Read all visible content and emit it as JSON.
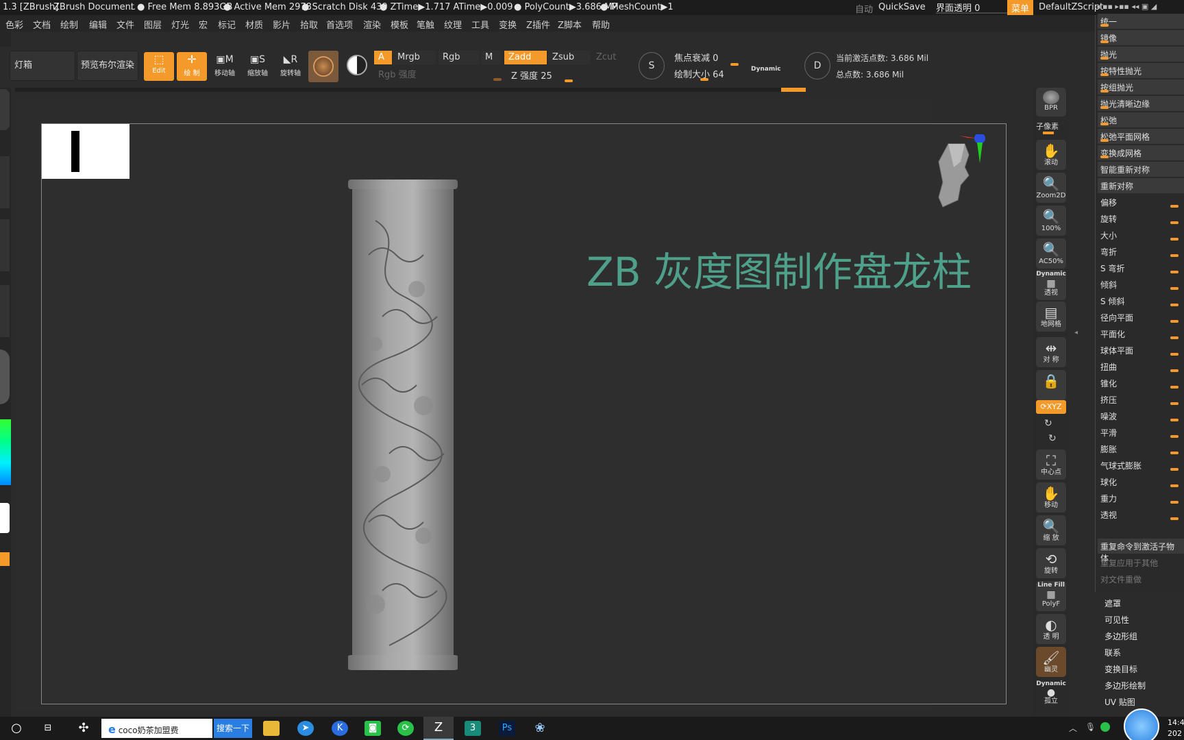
{
  "titlebar": {
    "app": "1.3 [ZBrush]",
    "document": "ZBrush Document",
    "free_mem": "Free Mem 8.893GB",
    "active_mem": "Active Mem 2978",
    "scratch": "Scratch Disk 439",
    "ztime": "ZTime▶1.717 ATime▶0.009",
    "polycount": "PolyCount▶3.686 MP",
    "meshcount": "MeshCount▶1",
    "auto": "自动",
    "quicksave": "QuickSave",
    "ui_transparency": "界面透明 0",
    "menu": "菜单",
    "default_script": "DefaultZScript"
  },
  "menu": [
    "色彩",
    "文档",
    "绘制",
    "编辑",
    "文件",
    "图层",
    "灯光",
    "宏",
    "标记",
    "材质",
    "影片",
    "拾取",
    "首选项",
    "渲染",
    "模板",
    "笔触",
    "纹理",
    "工具",
    "变换",
    "Z插件",
    "Z脚本",
    "帮助"
  ],
  "toolbar": {
    "lightbox": "灯箱",
    "preview_bpr": "预览布尔渲染",
    "edit": "Edit",
    "draw": "绘 制",
    "move": "移动轴",
    "scale": "缩放轴",
    "rotate": "旋转轴",
    "a": "A",
    "mrgb": "Mrgb",
    "rgb": "Rgb",
    "m": "M",
    "zadd": "Zadd",
    "zsub": "Zsub",
    "zcut": "Zcut",
    "rgb_intensity": "Rgb 强度",
    "z_intensity": "Z 强度",
    "z_intensity_value": "25",
    "focal_shift": "焦点衰减",
    "focal_shift_value": "0",
    "draw_size": "绘制大小",
    "draw_size_value": "64",
    "dynamic": "Dynamic",
    "active_points": "当前激活点数: 3.686 Mil",
    "total_points": "总点数: 3.686 Mil",
    "s_label": "S",
    "d_label": "D"
  },
  "canvas": {
    "overlay_title": "ZB 灰度图制作盘龙柱"
  },
  "right_shelf": [
    {
      "icon": "bpr-icon",
      "label": "BPR"
    },
    {
      "icon": "subpixel-icon",
      "label": "子像素"
    },
    {
      "icon": "scroll-icon",
      "label": "滚动"
    },
    {
      "icon": "zoom2d-icon",
      "label": "Zoom2D"
    },
    {
      "icon": "zoom100-icon",
      "label": "100%"
    },
    {
      "icon": "ac50-icon",
      "label": "AC50%"
    },
    {
      "icon": "perspective-icon",
      "label": "透视"
    },
    {
      "icon": "floor-icon",
      "label": "地网格"
    },
    {
      "icon": "symmetry-icon",
      "label": "对 称"
    },
    {
      "icon": "lock-icon",
      "label": ""
    },
    {
      "icon": "xyz-icon",
      "label": "XYZ"
    },
    {
      "icon": "center-icon",
      "label": "中心点"
    },
    {
      "icon": "move-hand-icon",
      "label": "移动"
    },
    {
      "icon": "scale-view-icon",
      "label": "缩 放"
    },
    {
      "icon": "rotate-view-icon",
      "label": "旋转"
    },
    {
      "icon": "polyframe-icon",
      "label": "PolyF"
    },
    {
      "icon": "transp-icon",
      "label": "透 明"
    },
    {
      "icon": "ghost-icon",
      "label": "幽灵"
    },
    {
      "icon": "solo-icon",
      "label": "孤立"
    }
  ],
  "shelf_extra": {
    "linefill": "Line Fill",
    "dynamic": "Dynamic",
    "dynamic2": "Dynamic"
  },
  "deformation": [
    {
      "label": "统一",
      "hdr": true
    },
    {
      "label": "镜像",
      "hdr": true
    },
    {
      "label": "抛光",
      "hdr": true
    },
    {
      "label": "按特性抛光",
      "hdr": true
    },
    {
      "label": "按组抛光",
      "hdr": true
    },
    {
      "label": "抛光清晰边缘",
      "hdr": true
    },
    {
      "label": "松弛",
      "hdr": true
    },
    {
      "label": "松弛平面网格",
      "hdr": true
    },
    {
      "label": "变换成网格",
      "hdr": true
    },
    {
      "label": "智能重新对称",
      "hdr": true
    },
    {
      "label": "重新对称",
      "hdr": true
    },
    {
      "label": "偏移",
      "hdr": false
    },
    {
      "label": "旋转",
      "hdr": false
    },
    {
      "label": "大小",
      "hdr": false
    },
    {
      "label": "弯折",
      "hdr": false
    },
    {
      "label": "S 弯折",
      "hdr": false
    },
    {
      "label": "倾斜",
      "hdr": false
    },
    {
      "label": "S 倾斜",
      "hdr": false
    },
    {
      "label": "径向平面",
      "hdr": false
    },
    {
      "label": "平面化",
      "hdr": false
    },
    {
      "label": "球体平面",
      "hdr": false
    },
    {
      "label": "扭曲",
      "hdr": false
    },
    {
      "label": "锥化",
      "hdr": false
    },
    {
      "label": "挤压",
      "hdr": false
    },
    {
      "label": "噪波",
      "hdr": false
    },
    {
      "label": "平滑",
      "hdr": false
    },
    {
      "label": "膨胀",
      "hdr": false
    },
    {
      "label": "气球式膨胀",
      "hdr": false
    },
    {
      "label": "球化",
      "hdr": false
    },
    {
      "label": "重力",
      "hdr": false
    },
    {
      "label": "透视",
      "hdr": false
    }
  ],
  "repeat": {
    "to_subtools": "重复命令到激活子物体",
    "apply_others": "重复应用于其他",
    "repeat_file": "对文件重做"
  },
  "tool_menu": [
    "遮罩",
    "可见性",
    "多边形组",
    "联系",
    "变换目标",
    "多边形绘制",
    "UV 贴图"
  ],
  "taskbar": {
    "search_text": "coco奶茶加盟费",
    "search_button": "搜索一下",
    "clock_time": "14:4",
    "clock_year": "202",
    "ps": "Ps",
    "k": "K"
  },
  "colors": {
    "accent": "#f39a2b",
    "title_text": "#4ea08a"
  }
}
